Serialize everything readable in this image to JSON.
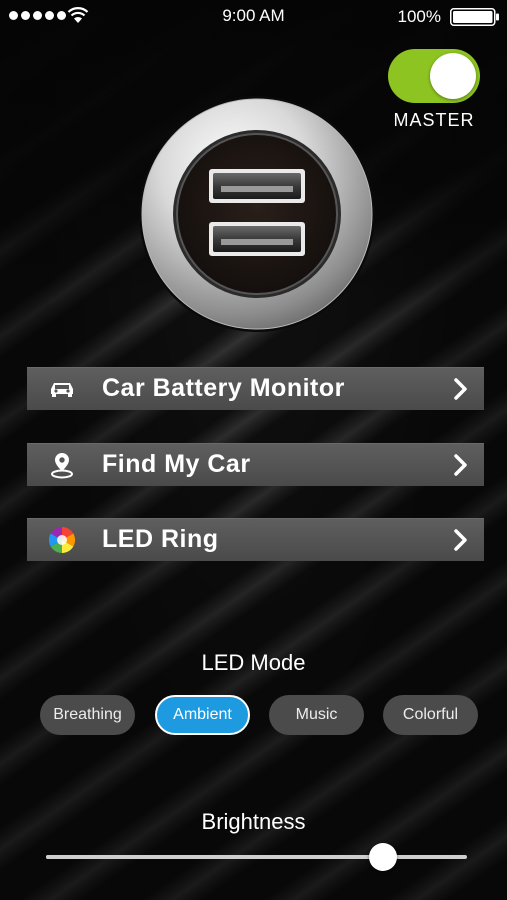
{
  "status_bar": {
    "time": "9:00 AM",
    "battery_percent": "100%"
  },
  "master": {
    "label": "MASTER",
    "on": true
  },
  "menu": [
    {
      "label": "Car Battery Monitor",
      "icon": "car-icon"
    },
    {
      "label": "Find My Car",
      "icon": "location-pin-icon"
    },
    {
      "label": "LED Ring",
      "icon": "color-wheel-icon"
    }
  ],
  "led_mode": {
    "title": "LED Mode",
    "options": [
      "Breathing",
      "Ambient",
      "Music",
      "Colorful"
    ],
    "selected": "Ambient"
  },
  "brightness": {
    "title": "Brightness",
    "value": 0.8
  },
  "colors": {
    "toggle_on": "#8dc421",
    "active_mode": "#1e9ae0",
    "menu_row": "#555555"
  }
}
